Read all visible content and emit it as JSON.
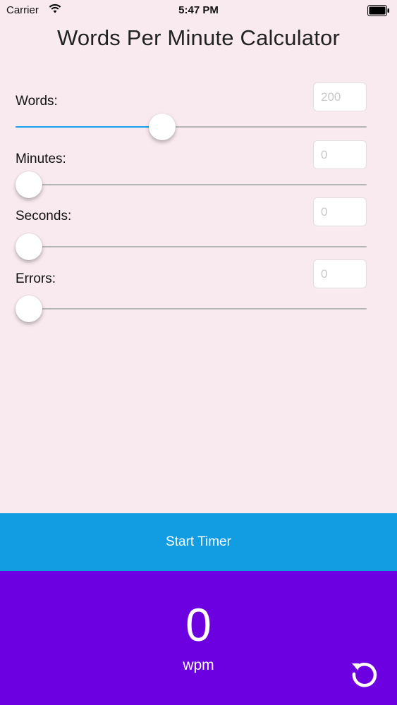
{
  "status_bar": {
    "carrier": "Carrier",
    "time": "5:47 PM"
  },
  "title": "Words Per Minute Calculator",
  "controls": [
    {
      "label": "Words:",
      "value": "200",
      "fraction": 0.41
    },
    {
      "label": "Minutes:",
      "value": "0",
      "fraction": 0.0
    },
    {
      "label": "Seconds:",
      "value": "0",
      "fraction": 0.0
    },
    {
      "label": "Errors:",
      "value": "0",
      "fraction": 0.0
    }
  ],
  "start_button": {
    "label": "Start Timer"
  },
  "result": {
    "value": "0",
    "unit": "wpm"
  },
  "colors": {
    "background": "#f9eaef",
    "slider_fill": "#1aa0e6",
    "start_button": "#129de3",
    "result_panel": "#6d00e0"
  },
  "icons": {
    "reset": "reset-icon"
  }
}
